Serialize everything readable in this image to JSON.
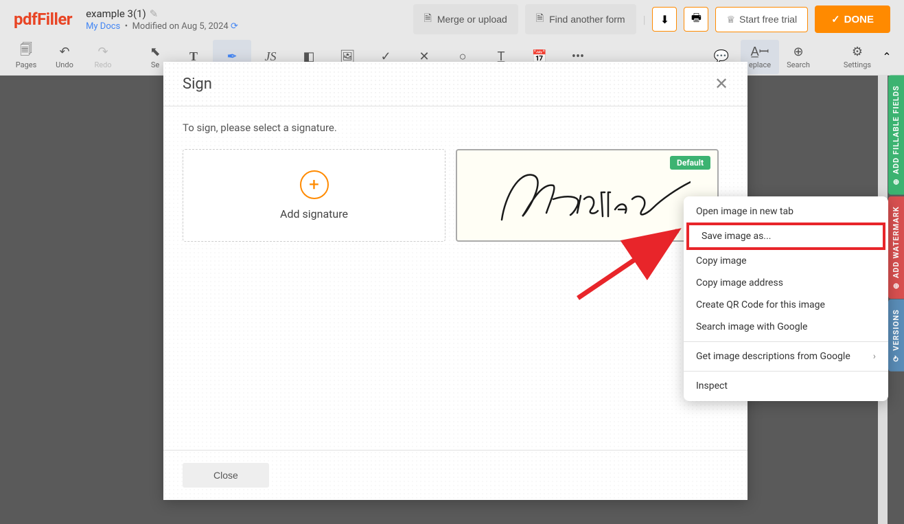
{
  "header": {
    "logo": "pdfFiller",
    "doc_title": "example 3(1)",
    "my_docs": "My Docs",
    "modified": "Modified on Aug 5, 2024",
    "merge": "Merge or upload",
    "find": "Find another form",
    "trial": "Start free trial",
    "done": "DONE"
  },
  "toolbar": {
    "pages": "Pages",
    "undo": "Undo",
    "redo": "Redo",
    "select": "Se",
    "replace": "eplace",
    "search": "Search",
    "settings": "Settings"
  },
  "modal": {
    "title": "Sign",
    "prompt": "To sign, please select a signature.",
    "add_signature": "Add signature",
    "default_badge": "Default",
    "signature_text": "Ravellin",
    "close": "Close"
  },
  "context_menu": {
    "items": [
      "Open image in new tab",
      "Save image as...",
      "Copy image",
      "Copy image address",
      "Create QR Code for this image",
      "Search image with Google"
    ],
    "desc_item": "Get image descriptions from Google",
    "inspect": "Inspect"
  },
  "side_tabs": {
    "fields": "ADD FILLABLE FIELDS",
    "watermark": "ADD WATERMARK",
    "versions": "VERSIONS"
  }
}
